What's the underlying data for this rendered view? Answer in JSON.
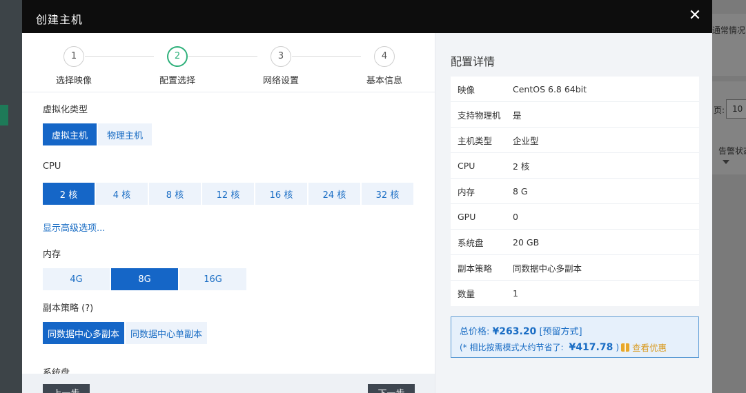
{
  "background": {
    "right_text_1": "通常情况",
    "right_text_2": "页:",
    "page_size_value": "10",
    "right_text_3": "告警状态"
  },
  "modal": {
    "title": "创建主机",
    "close_label": "✕"
  },
  "steps": [
    {
      "num": "1",
      "label": "选择映像"
    },
    {
      "num": "2",
      "label": "配置选择",
      "active": true
    },
    {
      "num": "3",
      "label": "网络设置"
    },
    {
      "num": "4",
      "label": "基本信息"
    }
  ],
  "virtualization": {
    "title": "虚拟化类型",
    "options": [
      "虚拟主机",
      "物理主机"
    ],
    "selected": "虚拟主机"
  },
  "cpu": {
    "title": "CPU",
    "options": [
      "2 核",
      "4 核",
      "8 核",
      "12 核",
      "16 核",
      "24 核",
      "32 核"
    ],
    "selected": "2 核"
  },
  "advanced_link": "显示高级选项...",
  "memory": {
    "title": "内存",
    "options": [
      "4G",
      "8G",
      "16G"
    ],
    "selected": "8G"
  },
  "replica": {
    "title": "副本策略 (?)",
    "options": [
      "同数据中心多副本",
      "同数据中心单副本"
    ],
    "selected": "同数据中心多副本"
  },
  "system_disk_title": "系统盘",
  "footer": {
    "prev_label": "上一步",
    "next_label": "下一步"
  },
  "details": {
    "title": "配置详情",
    "rows": [
      {
        "k": "映像",
        "v": "CentOS 6.8 64bit"
      },
      {
        "k": "支持物理机",
        "v": "是"
      },
      {
        "k": "主机类型",
        "v": "企业型"
      },
      {
        "k": "CPU",
        "v": "2 核"
      },
      {
        "k": "内存",
        "v": "8 G"
      },
      {
        "k": "GPU",
        "v": "0"
      },
      {
        "k": "系统盘",
        "v": "20 GB"
      },
      {
        "k": "副本策略",
        "v": "同数据中心多副本"
      },
      {
        "k": "数量",
        "v": "1"
      }
    ]
  },
  "price": {
    "label": "总价格:",
    "amount": "¥263.20",
    "mode": "[预留方式]",
    "save_prefix": "(* 相比按需模式大约节省了:",
    "save_amount": "¥417.78",
    "save_suffix": ")",
    "offer_label": "查看优惠"
  },
  "colors": {
    "primary": "#1566c7",
    "option_bg": "#edf3fb",
    "step_active": "#2eb07a",
    "header_bg": "#0d0d0d",
    "offer": "#d99a1f"
  }
}
